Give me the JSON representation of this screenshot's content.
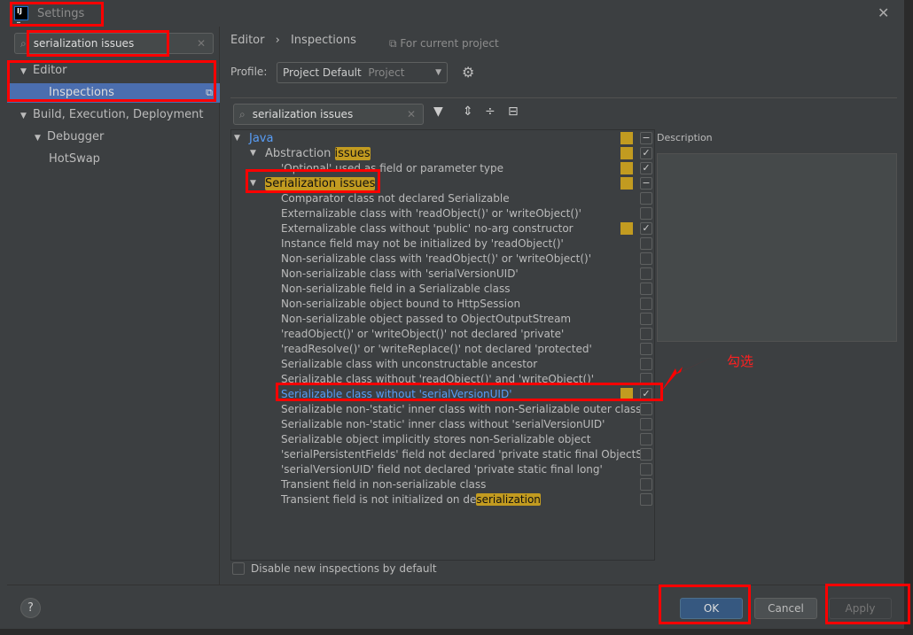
{
  "window": {
    "title": "Settings",
    "logo": "IJ"
  },
  "sidebar": {
    "search_value": "serialization issues",
    "items": [
      {
        "label": "Editor",
        "depth": 0,
        "expanded": true,
        "selected": false
      },
      {
        "label": "Inspections",
        "depth": 2,
        "expanded": null,
        "selected": true
      },
      {
        "label": "Build, Execution, Deployment",
        "depth": 0,
        "expanded": true,
        "selected": false
      },
      {
        "label": "Debugger",
        "depth": 1,
        "expanded": true,
        "selected": false
      },
      {
        "label": "HotSwap",
        "depth": 2,
        "expanded": null,
        "selected": false
      }
    ]
  },
  "header": {
    "breadcrumb_parent": "Editor",
    "breadcrumb_sep": "›",
    "breadcrumb_current": "Inspections",
    "for_current_project": "For current project"
  },
  "profile": {
    "label": "Profile:",
    "value": "Project Default",
    "scope": "Project"
  },
  "filter": {
    "search_value": "serialization issues"
  },
  "tree": [
    {
      "label": "Java",
      "depth": 0,
      "group": true,
      "link": true,
      "marker": true,
      "check": "partial"
    },
    {
      "label": "Abstraction ",
      "highlight": "issues",
      "depth": 1,
      "group": true,
      "marker": true,
      "check": "checked"
    },
    {
      "label": "'Optional' used as field or parameter type",
      "depth": 2,
      "marker": true,
      "check": "checked"
    },
    {
      "label": "",
      "highlight": "Serialization issues",
      "depth": 1,
      "group": true,
      "marker": true,
      "check": "partial"
    },
    {
      "label": "Comparator class not declared Serializable",
      "depth": 2,
      "check": "unchecked"
    },
    {
      "label": "Externalizable class with 'readObject()' or 'writeObject()'",
      "depth": 2,
      "check": "unchecked"
    },
    {
      "label": "Externalizable class without 'public' no-arg constructor",
      "depth": 2,
      "marker": true,
      "check": "checked"
    },
    {
      "label": "Instance field may not be initialized by 'readObject()'",
      "depth": 2,
      "check": "unchecked"
    },
    {
      "label": "Non-serializable class with 'readObject()' or 'writeObject()'",
      "depth": 2,
      "check": "unchecked"
    },
    {
      "label": "Non-serializable class with 'serialVersionUID'",
      "depth": 2,
      "check": "unchecked"
    },
    {
      "label": "Non-serializable field in a Serializable class",
      "depth": 2,
      "check": "unchecked"
    },
    {
      "label": "Non-serializable object bound to HttpSession",
      "depth": 2,
      "check": "unchecked"
    },
    {
      "label": "Non-serializable object passed to ObjectOutputStream",
      "depth": 2,
      "check": "unchecked"
    },
    {
      "label": "'readObject()' or 'writeObject()' not declared 'private'",
      "depth": 2,
      "check": "unchecked"
    },
    {
      "label": "'readResolve()' or 'writeReplace()' not declared 'protected'",
      "depth": 2,
      "check": "unchecked"
    },
    {
      "label": "Serializable class with unconstructable ancestor",
      "depth": 2,
      "check": "unchecked"
    },
    {
      "label": "Serializable class without 'readObject()' and 'writeObject()'",
      "depth": 2,
      "check": "unchecked"
    },
    {
      "label": "Serializable class without 'serialVersionUID'",
      "depth": 2,
      "link": true,
      "marker": true,
      "check": "checked"
    },
    {
      "label": "Serializable non-'static' inner class with non-Serializable outer class",
      "depth": 2,
      "check": "unchecked"
    },
    {
      "label": "Serializable non-'static' inner class without 'serialVersionUID'",
      "depth": 2,
      "check": "unchecked"
    },
    {
      "label": "Serializable object implicitly stores non-Serializable object",
      "depth": 2,
      "check": "unchecked"
    },
    {
      "label": "'serialPersistentFields' field not declared 'private static final ObjectSt",
      "depth": 2,
      "check": "unchecked"
    },
    {
      "label": "'serialVersionUID' field not declared 'private static final long'",
      "depth": 2,
      "check": "unchecked"
    },
    {
      "label": "Transient field in non-serializable class",
      "depth": 2,
      "check": "unchecked"
    },
    {
      "label": "Transient field is not initialized on de",
      "highlight": "serialization",
      "depth": 2,
      "check": "unchecked"
    }
  ],
  "description": {
    "label": "Description"
  },
  "options": {
    "disable_new": "Disable new inspections by default",
    "disable_new_checked": false
  },
  "footer": {
    "help": "?",
    "ok": "OK",
    "cancel": "Cancel",
    "apply": "Apply"
  },
  "annotation": {
    "text": "勾选"
  },
  "colors": {
    "accent": "#4b6eaf",
    "highlight": "#c29b20",
    "link": "#589df6",
    "annotation": "#ff0000"
  }
}
